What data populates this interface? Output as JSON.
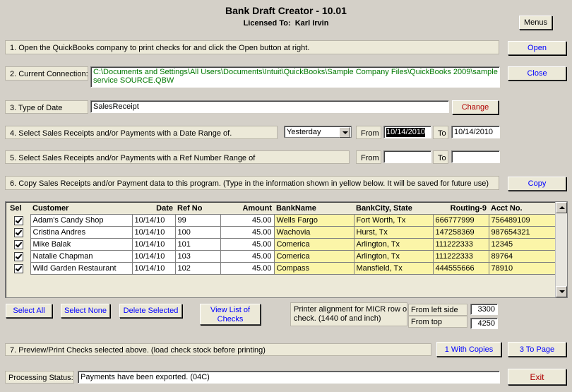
{
  "header": {
    "title": "Bank Draft Creator - 10.01",
    "licensed_label": "Licensed To:",
    "licensee": "Karl Irvin"
  },
  "buttons": {
    "menus": "Menus",
    "open": "Open",
    "close": "Close",
    "change": "Change",
    "copy": "Copy",
    "select_all": "Select All",
    "select_none": "Select None",
    "delete_selected": "Delete Selected",
    "view_list_line1": "View List of",
    "view_list_line2": "Checks",
    "with_copies": "1 With Copies",
    "to_page": "3 To Page",
    "exit": "Exit"
  },
  "steps": {
    "s1": "1. Open the QuickBooks company to print checks for and click the Open button at right.",
    "s2": "2. Current Connection:",
    "s3": "3. Type of Date",
    "s4": "4. Select Sales Receipts and/or Payments with a Date Range of.",
    "s5": "5. Select Sales Receipts and/or Payments with a Ref Number Range of",
    "s6": "6. Copy Sales Receipts and/or Payment data to this program. (Type in the information shown in yellow below. It will be saved for future use)",
    "s7": "7. Preview/Print Checks selected above. (load check stock before printing)"
  },
  "connection": {
    "line1": "C:\\Documents and Settings\\All Users\\Documents\\Intuit\\QuickBooks\\Sample Company Files\\QuickBooks 2009\\sample",
    "line2": "service SOURCE.QBW"
  },
  "date_type": "SalesReceipt",
  "date_range": {
    "preset": "Yesterday",
    "from_label": "From",
    "to_label": "To",
    "from": "10/14/2010",
    "to": "10/14/2010"
  },
  "ref_range": {
    "from_label": "From",
    "to_label": "To",
    "from": "",
    "to": ""
  },
  "grid": {
    "columns": [
      "Sel",
      "Customer",
      "Date",
      "Ref No",
      "Amount",
      "BankName",
      "BankCity, State",
      "Routing-9",
      "Acct No."
    ],
    "rows": [
      {
        "customer": "Adam's Candy Shop",
        "date": "10/14/10",
        "ref": "99",
        "amount": "45.00",
        "bank": "Wells Fargo",
        "city": "Fort Worth, Tx",
        "routing": "666777999",
        "acct": "756489109"
      },
      {
        "customer": "Cristina Andres",
        "date": "10/14/10",
        "ref": "100",
        "amount": "45.00",
        "bank": "Wachovia",
        "city": "Hurst, Tx",
        "routing": "147258369",
        "acct": "987654321"
      },
      {
        "customer": "Mike Balak",
        "date": "10/14/10",
        "ref": "101",
        "amount": "45.00",
        "bank": "Comerica",
        "city": "Arlington, Tx",
        "routing": "111222333",
        "acct": "12345"
      },
      {
        "customer": "Natalie Chapman",
        "date": "10/14/10",
        "ref": "103",
        "amount": "45.00",
        "bank": "Comerica",
        "city": "Arlington, Tx",
        "routing": "111222333",
        "acct": "89764"
      },
      {
        "customer": "Wild Garden Restaurant",
        "date": "10/14/10",
        "ref": "102",
        "amount": "45.00",
        "bank": "Compass",
        "city": "Mansfield, Tx",
        "routing": "444555666",
        "acct": "78910"
      }
    ]
  },
  "printer": {
    "alignment_line1": "Printer alignment for MICR row on",
    "alignment_line2": "check. (1440 of and inch)",
    "left_label": "From left side",
    "left_value": "3300",
    "top_label": "From top",
    "top_value": "4250"
  },
  "status": {
    "label": "Processing Status:",
    "value": "Payments have been exported. (04C)"
  }
}
